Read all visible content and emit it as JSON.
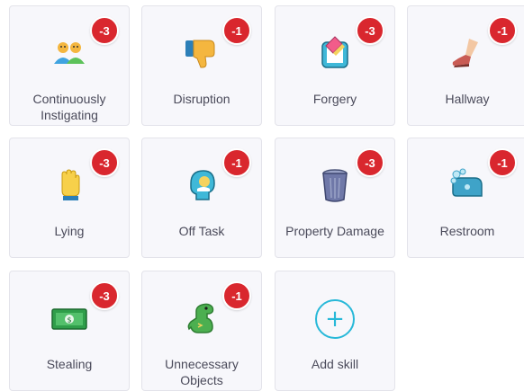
{
  "skills": [
    {
      "label": "Continuously Instigating",
      "points": "-3",
      "icon": "people-icon"
    },
    {
      "label": "Disruption",
      "points": "-1",
      "icon": "thumbs-down-icon"
    },
    {
      "label": "Forgery",
      "points": "-3",
      "icon": "eraser-icon"
    },
    {
      "label": "Hallway",
      "points": "-1",
      "icon": "boot-icon"
    },
    {
      "label": "Lying",
      "points": "-3",
      "icon": "hand-icon"
    },
    {
      "label": "Off Task",
      "points": "-1",
      "icon": "head-sun-icon"
    },
    {
      "label": "Property Damage",
      "points": "-3",
      "icon": "trash-can-icon"
    },
    {
      "label": "Restroom",
      "points": "-1",
      "icon": "soap-hands-icon"
    },
    {
      "label": "Stealing",
      "points": "-3",
      "icon": "money-icon"
    },
    {
      "label": "Unnecessary Objects",
      "points": "-1",
      "icon": "dinosaur-icon"
    }
  ],
  "add_skill": {
    "label": "Add skill",
    "icon": "plus-icon"
  },
  "colors": {
    "badge": "#d9272e",
    "accent": "#27b8d8",
    "card_bg": "#f7f7fb",
    "text": "#4a4a5a"
  }
}
